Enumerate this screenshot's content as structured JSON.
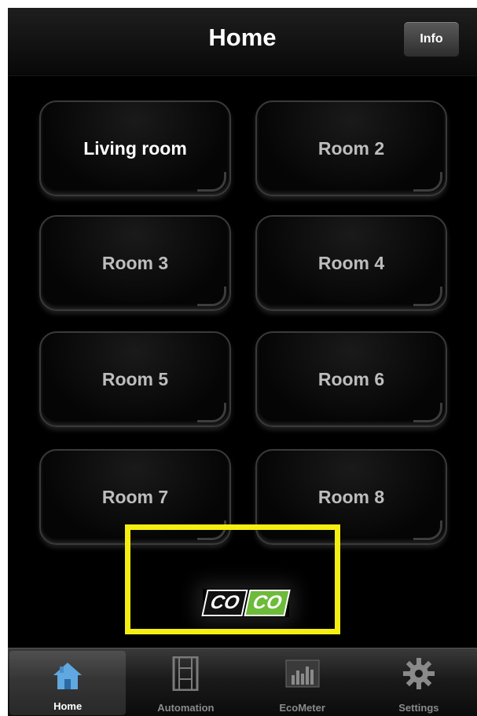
{
  "navbar": {
    "title": "Home",
    "info_label": "Info"
  },
  "rooms": [
    {
      "label": "Living room",
      "selected": true
    },
    {
      "label": "Room 2",
      "selected": false
    },
    {
      "label": "Room 3",
      "selected": false
    },
    {
      "label": "Room 4",
      "selected": false
    },
    {
      "label": "Room 5",
      "selected": false
    },
    {
      "label": "Room 6",
      "selected": false
    },
    {
      "label": "Room 7",
      "selected": false
    },
    {
      "label": "Room 8",
      "selected": false
    }
  ],
  "logo": {
    "part_a": "CO",
    "part_b": "CO",
    "highlight_color": "#f5ee12",
    "accent_color": "#6dbb3a"
  },
  "tabbar": {
    "tabs": [
      {
        "label": "Home",
        "icon": "home-icon",
        "active": true
      },
      {
        "label": "Automation",
        "icon": "film-strip-icon",
        "active": false
      },
      {
        "label": "EcoMeter",
        "icon": "bar-meter-icon",
        "active": false
      },
      {
        "label": "Settings",
        "icon": "gear-icon",
        "active": false
      }
    ]
  }
}
